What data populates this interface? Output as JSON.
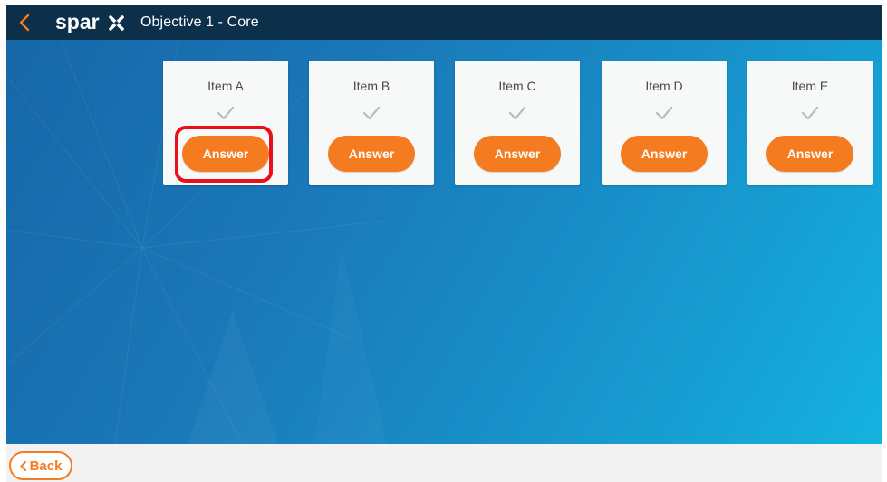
{
  "header": {
    "logo_text": "sparx",
    "title": "Objective 1 - Core",
    "back_icon": "chevron-left-icon"
  },
  "items": [
    {
      "label": "Item A",
      "answer_label": "Answer",
      "check_icon": "check-icon",
      "highlighted": true
    },
    {
      "label": "Item B",
      "answer_label": "Answer",
      "check_icon": "check-icon",
      "highlighted": false
    },
    {
      "label": "Item C",
      "answer_label": "Answer",
      "check_icon": "check-icon",
      "highlighted": false
    },
    {
      "label": "Item D",
      "answer_label": "Answer",
      "check_icon": "check-icon",
      "highlighted": false
    },
    {
      "label": "Item E",
      "answer_label": "Answer",
      "check_icon": "check-icon",
      "highlighted": false
    }
  ],
  "footer": {
    "back_label": "Back",
    "back_icon": "chevron-left-icon"
  },
  "colors": {
    "header_bg": "#0c2f4a",
    "accent": "#f47b20",
    "highlight": "#e8101a",
    "card_bg": "#f7f8f8"
  }
}
